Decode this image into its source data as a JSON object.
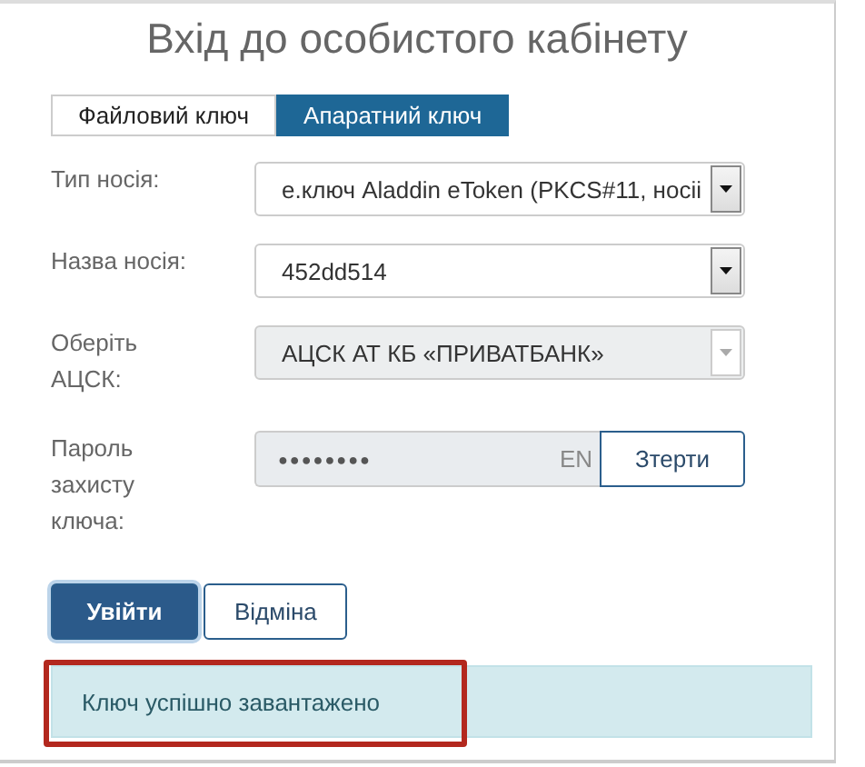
{
  "title": "Вхід до особистого кабінету",
  "tabs": [
    {
      "label": "Файловий ключ",
      "selected": false
    },
    {
      "label": "Апаратний ключ",
      "selected": true
    }
  ],
  "fields": [
    {
      "kind": "select",
      "label": "Тип носія:",
      "value": "е.ключ Aladdin eToken (PKCS#11, носіі",
      "disabled": false
    },
    {
      "kind": "select",
      "label": "Назва носія:",
      "value": "452dd514",
      "disabled": false
    },
    {
      "kind": "select",
      "label": "Оберіть АЦСК:",
      "value": "АЦСК АТ КБ «ПРИВАТБАНК»",
      "disabled": true
    },
    {
      "kind": "password",
      "label": "Пароль захисту ключа:",
      "value": "●●●●●●●●",
      "lang": "EN",
      "button": "Зтерти",
      "disabled": true
    }
  ],
  "buttons": [
    {
      "label": "Увійти",
      "primary": true
    },
    {
      "label": "Відміна",
      "primary": false
    }
  ],
  "alert": {
    "text": "Ключ успішно завантажено",
    "highlighted": true
  }
}
